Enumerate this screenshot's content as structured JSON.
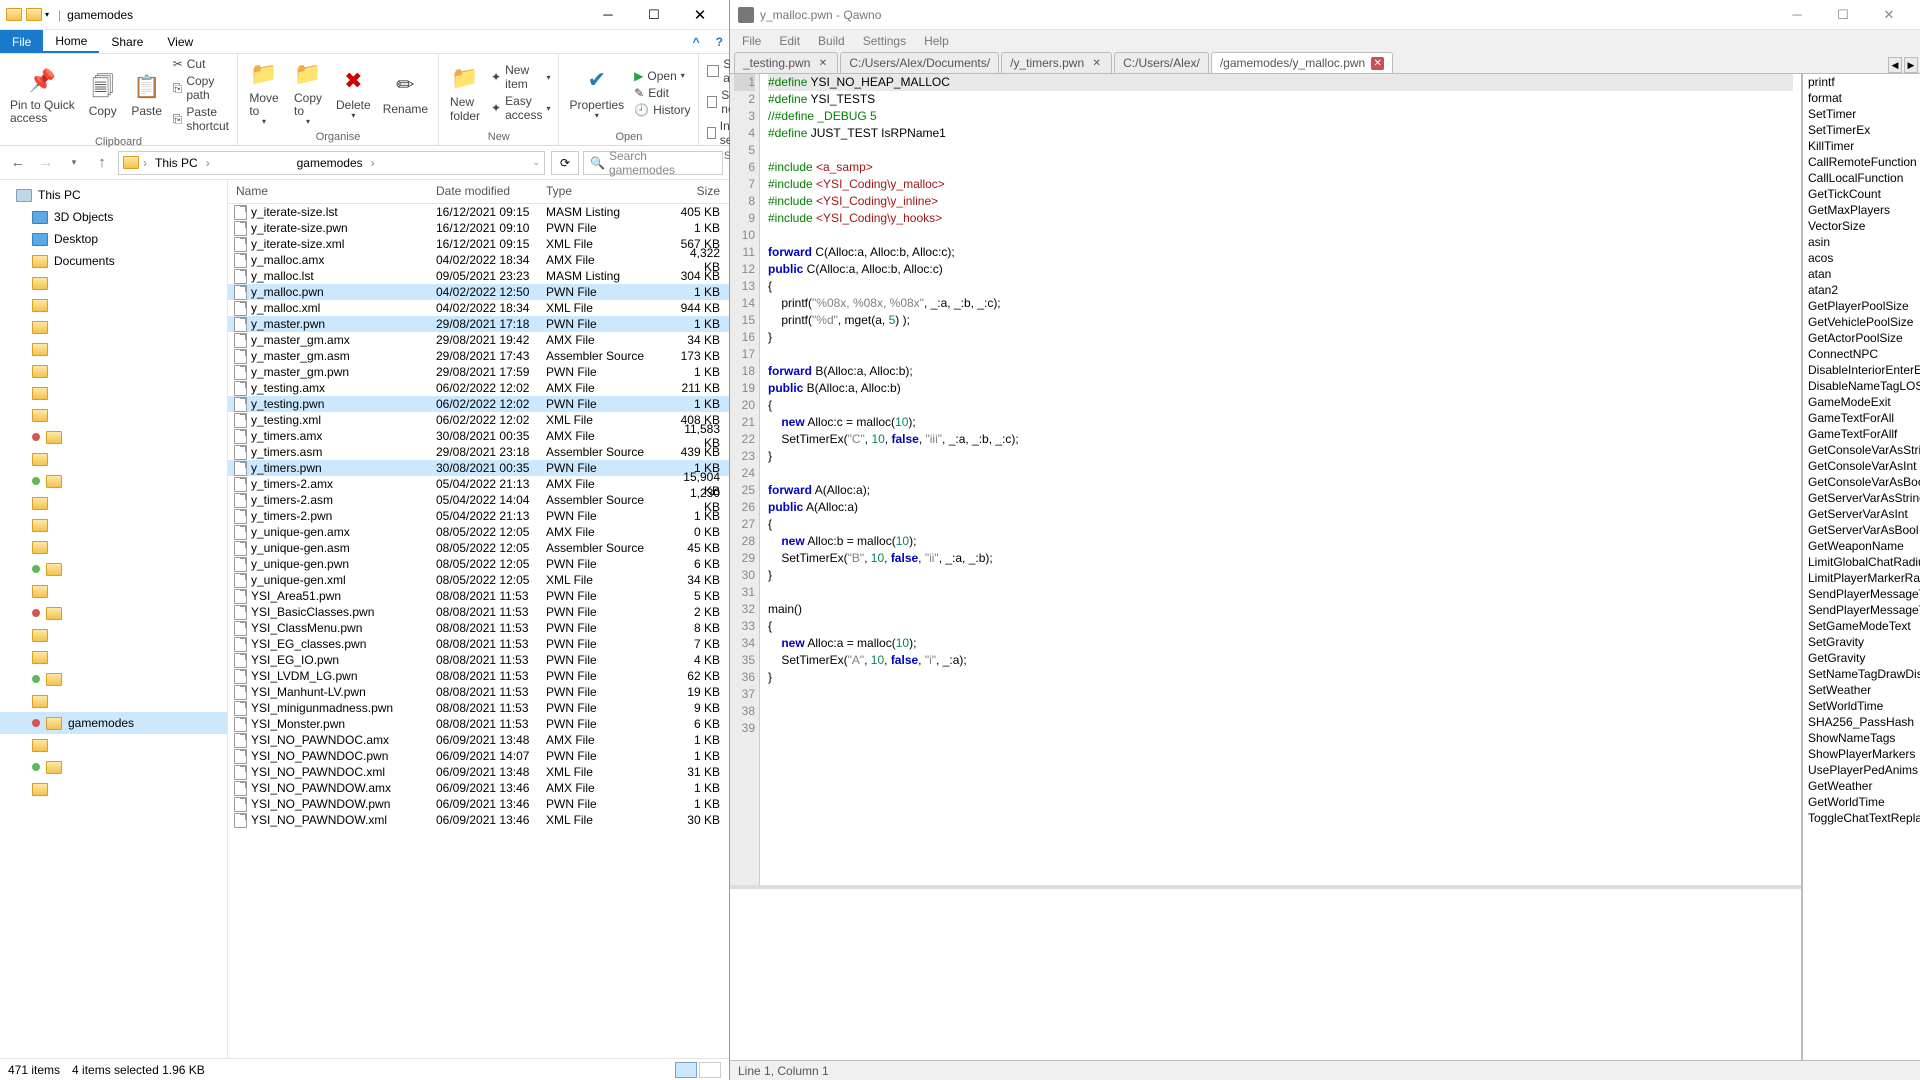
{
  "fe": {
    "title": "gamemodes",
    "menu": {
      "file": "File",
      "home": "Home",
      "share": "Share",
      "view": "View"
    },
    "ribbon": {
      "pin": "Pin to Quick\naccess",
      "copy": "Copy",
      "paste": "Paste",
      "cut": "Cut",
      "copypath": "Copy path",
      "pasteshort": "Paste shortcut",
      "clipboard": "Clipboard",
      "moveto": "Move\nto",
      "copyto": "Copy\nto",
      "delete": "Delete",
      "rename": "Rename",
      "organise": "Organise",
      "newfolder": "New\nfolder",
      "newitem": "New item",
      "easyaccess": "Easy access",
      "new": "New",
      "properties": "Properties",
      "open": "Open",
      "edit": "Edit",
      "history": "History",
      "open_g": "Open",
      "selectall": "Select all",
      "selectnone": "Select none",
      "invert": "Invert selection",
      "select": "Select"
    },
    "addr": {
      "crumb1": "This PC",
      "crumb2": "gamemodes",
      "search_ph": "Search gamemodes"
    },
    "nav": {
      "thispc": "This PC",
      "d3": "3D Objects",
      "desktop": "Desktop",
      "documents": "Documents",
      "gamemodes": "gamemodes"
    },
    "cols": {
      "name": "Name",
      "date": "Date modified",
      "type": "Type",
      "size": "Size"
    },
    "files": [
      {
        "n": "y_iterate-size.lst",
        "d": "16/12/2021 09:15",
        "t": "MASM Listing",
        "s": "405 KB"
      },
      {
        "n": "y_iterate-size.pwn",
        "d": "16/12/2021 09:10",
        "t": "PWN File",
        "s": "1 KB"
      },
      {
        "n": "y_iterate-size.xml",
        "d": "16/12/2021 09:15",
        "t": "XML File",
        "s": "567 KB"
      },
      {
        "n": "y_malloc.amx",
        "d": "04/02/2022 18:34",
        "t": "AMX File",
        "s": "4,322 KB"
      },
      {
        "n": "y_malloc.lst",
        "d": "09/05/2021 23:23",
        "t": "MASM Listing",
        "s": "304 KB"
      },
      {
        "n": "y_malloc.pwn",
        "d": "04/02/2022 12:50",
        "t": "PWN File",
        "s": "1 KB",
        "sel": true
      },
      {
        "n": "y_malloc.xml",
        "d": "04/02/2022 18:34",
        "t": "XML File",
        "s": "944 KB"
      },
      {
        "n": "y_master.pwn",
        "d": "29/08/2021 17:18",
        "t": "PWN File",
        "s": "1 KB",
        "sel": true
      },
      {
        "n": "y_master_gm.amx",
        "d": "29/08/2021 19:42",
        "t": "AMX File",
        "s": "34 KB"
      },
      {
        "n": "y_master_gm.asm",
        "d": "29/08/2021 17:43",
        "t": "Assembler Source",
        "s": "173 KB"
      },
      {
        "n": "y_master_gm.pwn",
        "d": "29/08/2021 17:59",
        "t": "PWN File",
        "s": "1 KB"
      },
      {
        "n": "y_testing.amx",
        "d": "06/02/2022 12:02",
        "t": "AMX File",
        "s": "211 KB"
      },
      {
        "n": "y_testing.pwn",
        "d": "06/02/2022 12:02",
        "t": "PWN File",
        "s": "1 KB",
        "sel": true
      },
      {
        "n": "y_testing.xml",
        "d": "06/02/2022 12:02",
        "t": "XML File",
        "s": "408 KB"
      },
      {
        "n": "y_timers.amx",
        "d": "30/08/2021 00:35",
        "t": "AMX File",
        "s": "11,583 KB"
      },
      {
        "n": "y_timers.asm",
        "d": "29/08/2021 23:18",
        "t": "Assembler Source",
        "s": "439 KB"
      },
      {
        "n": "y_timers.pwn",
        "d": "30/08/2021 00:35",
        "t": "PWN File",
        "s": "1 KB",
        "sel": true
      },
      {
        "n": "y_timers-2.amx",
        "d": "05/04/2022 21:13",
        "t": "AMX File",
        "s": "15,904 KB"
      },
      {
        "n": "y_timers-2.asm",
        "d": "05/04/2022 14:04",
        "t": "Assembler Source",
        "s": "1,230 KB"
      },
      {
        "n": "y_timers-2.pwn",
        "d": "05/04/2022 21:13",
        "t": "PWN File",
        "s": "1 KB"
      },
      {
        "n": "y_unique-gen.amx",
        "d": "08/05/2022 12:05",
        "t": "AMX File",
        "s": "0 KB"
      },
      {
        "n": "y_unique-gen.asm",
        "d": "08/05/2022 12:05",
        "t": "Assembler Source",
        "s": "45 KB"
      },
      {
        "n": "y_unique-gen.pwn",
        "d": "08/05/2022 12:05",
        "t": "PWN File",
        "s": "6 KB"
      },
      {
        "n": "y_unique-gen.xml",
        "d": "08/05/2022 12:05",
        "t": "XML File",
        "s": "34 KB"
      },
      {
        "n": "YSI_Area51.pwn",
        "d": "08/08/2021 11:53",
        "t": "PWN File",
        "s": "5 KB"
      },
      {
        "n": "YSI_BasicClasses.pwn",
        "d": "08/08/2021 11:53",
        "t": "PWN File",
        "s": "2 KB"
      },
      {
        "n": "YSI_ClassMenu.pwn",
        "d": "08/08/2021 11:53",
        "t": "PWN File",
        "s": "8 KB"
      },
      {
        "n": "YSI_EG_classes.pwn",
        "d": "08/08/2021 11:53",
        "t": "PWN File",
        "s": "7 KB"
      },
      {
        "n": "YSI_EG_IO.pwn",
        "d": "08/08/2021 11:53",
        "t": "PWN File",
        "s": "4 KB"
      },
      {
        "n": "YSI_LVDM_LG.pwn",
        "d": "08/08/2021 11:53",
        "t": "PWN File",
        "s": "62 KB"
      },
      {
        "n": "YSI_Manhunt-LV.pwn",
        "d": "08/08/2021 11:53",
        "t": "PWN File",
        "s": "19 KB"
      },
      {
        "n": "YSI_minigunmadness.pwn",
        "d": "08/08/2021 11:53",
        "t": "PWN File",
        "s": "9 KB"
      },
      {
        "n": "YSI_Monster.pwn",
        "d": "08/08/2021 11:53",
        "t": "PWN File",
        "s": "6 KB"
      },
      {
        "n": "YSI_NO_PAWNDOC.amx",
        "d": "06/09/2021 13:48",
        "t": "AMX File",
        "s": "1 KB"
      },
      {
        "n": "YSI_NO_PAWNDOC.pwn",
        "d": "06/09/2021 14:07",
        "t": "PWN File",
        "s": "1 KB"
      },
      {
        "n": "YSI_NO_PAWNDOC.xml",
        "d": "06/09/2021 13:48",
        "t": "XML File",
        "s": "31 KB"
      },
      {
        "n": "YSI_NO_PAWNDOW.amx",
        "d": "06/09/2021 13:46",
        "t": "AMX File",
        "s": "1 KB"
      },
      {
        "n": "YSI_NO_PAWNDOW.pwn",
        "d": "06/09/2021 13:46",
        "t": "PWN File",
        "s": "1 KB"
      },
      {
        "n": "YSI_NO_PAWNDOW.xml",
        "d": "06/09/2021 13:46",
        "t": "XML File",
        "s": "30 KB"
      }
    ],
    "status": {
      "items": "471 items",
      "sel": "4 items selected  1.96 KB"
    }
  },
  "ed": {
    "title": "y_malloc.pwn - Qawno",
    "menu": {
      "file": "File",
      "edit": "Edit",
      "build": "Build",
      "settings": "Settings",
      "help": "Help"
    },
    "tabs": [
      {
        "l": "_testing.pwn",
        "x": true
      },
      {
        "l": "C:/Users/Alex/Documents/",
        "x": false
      },
      {
        "l": "/y_timers.pwn",
        "x": true
      },
      {
        "l": "C:/Users/Alex/",
        "x": false
      },
      {
        "l": "/gamemodes/y_malloc.pwn",
        "x": true,
        "active": true
      }
    ],
    "code": [
      {
        "n": 1,
        "h": "<span class='tk-green'>#define</span> YSI_NO_HEAP_MALLOC"
      },
      {
        "n": 2,
        "h": "<span class='tk-green'>#define</span> YSI_TESTS"
      },
      {
        "n": 3,
        "h": "<span class='tk-green'>//#define _DEBUG 5</span>"
      },
      {
        "n": 4,
        "h": "<span class='tk-green'>#define</span> JUST_TEST IsRPName1"
      },
      {
        "n": 5,
        "h": ""
      },
      {
        "n": 6,
        "h": "<span class='tk-green'>#include</span> <span class='tk-red'>&lt;a_samp&gt;</span>"
      },
      {
        "n": 7,
        "h": "<span class='tk-green'>#include</span> <span class='tk-red'>&lt;YSI_Coding\\y_malloc&gt;</span>"
      },
      {
        "n": 8,
        "h": "<span class='tk-green'>#include</span> <span class='tk-red'>&lt;YSI_Coding\\y_inline&gt;</span>"
      },
      {
        "n": 9,
        "h": "<span class='tk-green'>#include</span> <span class='tk-red'>&lt;YSI_Coding\\y_hooks&gt;</span>"
      },
      {
        "n": 10,
        "h": ""
      },
      {
        "n": 11,
        "h": "<span class='tk-blue'>forward</span> C(Alloc:a, Alloc:b, Alloc:c);"
      },
      {
        "n": 12,
        "h": "<span class='tk-blue'>public</span> C(Alloc:a, Alloc:b, Alloc:c)"
      },
      {
        "n": 13,
        "h": "{"
      },
      {
        "n": 14,
        "h": "    printf(<span class='tk-gray'>\"%08x, %08x, %08x\"</span>, _:a, _:b, _:c);"
      },
      {
        "n": 15,
        "h": "    printf(<span class='tk-gray'>\"%d\"</span>, mget(a, <span class='tk-num'>5</span>) );"
      },
      {
        "n": 16,
        "h": "}"
      },
      {
        "n": 17,
        "h": ""
      },
      {
        "n": 18,
        "h": "<span class='tk-blue'>forward</span> B(Alloc:a, Alloc:b);"
      },
      {
        "n": 19,
        "h": "<span class='tk-blue'>public</span> B(Alloc:a, Alloc:b)"
      },
      {
        "n": 20,
        "h": "{"
      },
      {
        "n": 21,
        "h": "    <span class='tk-blue'>new</span> Alloc:c = malloc(<span class='tk-num'>10</span>);"
      },
      {
        "n": 22,
        "h": "    SetTimerEx(<span class='tk-gray'>\"C\"</span>, <span class='tk-num'>10</span>, <span class='tk-blue'>false</span>, <span class='tk-gray'>\"iii\"</span>, _:a, _:b, _:c);"
      },
      {
        "n": 23,
        "h": "}"
      },
      {
        "n": 24,
        "h": ""
      },
      {
        "n": 25,
        "h": "<span class='tk-blue'>forward</span> A(Alloc:a);"
      },
      {
        "n": 26,
        "h": "<span class='tk-blue'>public</span> A(Alloc:a)"
      },
      {
        "n": 27,
        "h": "{"
      },
      {
        "n": 28,
        "h": "    <span class='tk-blue'>new</span> Alloc:b = malloc(<span class='tk-num'>10</span>);"
      },
      {
        "n": 29,
        "h": "    SetTimerEx(<span class='tk-gray'>\"B\"</span>, <span class='tk-num'>10</span>, <span class='tk-blue'>false</span>, <span class='tk-gray'>\"ii\"</span>, _:a, _:b);"
      },
      {
        "n": 30,
        "h": "}"
      },
      {
        "n": 31,
        "h": ""
      },
      {
        "n": 32,
        "h": "main()"
      },
      {
        "n": 33,
        "h": "{"
      },
      {
        "n": 34,
        "h": "    <span class='tk-blue'>new</span> Alloc:a = malloc(<span class='tk-num'>10</span>);"
      },
      {
        "n": 35,
        "h": "    SetTimerEx(<span class='tk-gray'>\"A\"</span>, <span class='tk-num'>10</span>, <span class='tk-blue'>false</span>, <span class='tk-gray'>\"i\"</span>, _:a);"
      },
      {
        "n": 36,
        "h": "}"
      },
      {
        "n": 37,
        "h": ""
      },
      {
        "n": 38,
        "h": ""
      },
      {
        "n": 39,
        "h": ""
      }
    ],
    "side": [
      "printf",
      "format",
      "SetTimer",
      "SetTimerEx",
      "KillTimer",
      "CallRemoteFunction",
      "CallLocalFunction",
      "GetTickCount",
      "GetMaxPlayers",
      "VectorSize",
      "asin",
      "acos",
      "atan",
      "atan2",
      "GetPlayerPoolSize",
      "GetVehiclePoolSize",
      "GetActorPoolSize",
      "ConnectNPC",
      "DisableInteriorEnterExits",
      "DisableNameTagLOS",
      "GameModeExit",
      "GameTextForAll",
      "GameTextForAllf",
      "GetConsoleVarAsString",
      "GetConsoleVarAsInt",
      "GetConsoleVarAsBool",
      "GetServerVarAsString",
      "GetServerVarAsInt",
      "GetServerVarAsBool",
      "GetWeaponName",
      "LimitGlobalChatRadius",
      "LimitPlayerMarkerRadius",
      "SendPlayerMessageToAll",
      "SendPlayerMessageToPlayer",
      "SetGameModeText",
      "SetGravity",
      "GetGravity",
      "SetNameTagDrawDistance",
      "SetWeather",
      "SetWorldTime",
      "SHA256_PassHash",
      "ShowNameTags",
      "ShowPlayerMarkers",
      "UsePlayerPedAnims",
      "GetWeather",
      "GetWorldTime",
      "ToggleChatTextReplacement"
    ],
    "status": "Line 1, Column 1"
  }
}
